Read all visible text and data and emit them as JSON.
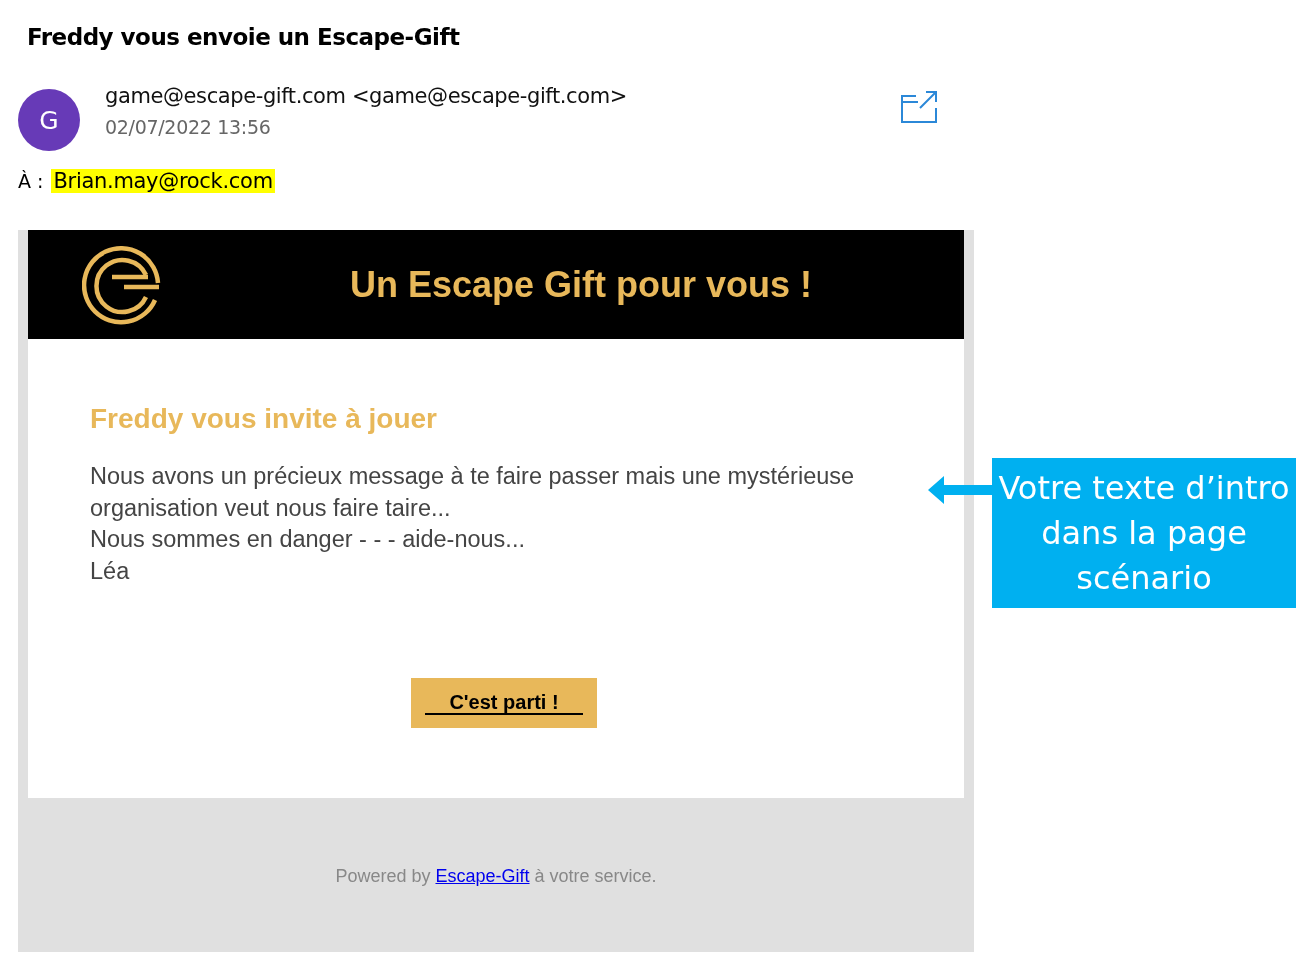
{
  "subject": "Freddy vous envoie un Escape-Gift",
  "sender": {
    "avatar_letter": "G",
    "name": "game@escape-gift.com <game@escape-gift.com>",
    "date": "02/07/2022 13:56"
  },
  "recipient": {
    "label": "À :",
    "address": "Brian.may@rock.com"
  },
  "email": {
    "banner_title": "Un Escape Gift pour vous !",
    "heading": "Freddy vous invite à jouer",
    "body_lines": [
      "Nous avons un précieux message à te faire passer mais une mystérieuse",
      "organisation veut nous faire taire...",
      "Nous sommes en danger - - - aide-nous...",
      "Léa"
    ],
    "button": "C'est parti !",
    "footer": {
      "before": "Powered by ",
      "link": "Escape-Gift",
      "after": " à votre service."
    }
  },
  "annotation": {
    "text": "Votre texte d’intro dans la page scénario"
  }
}
